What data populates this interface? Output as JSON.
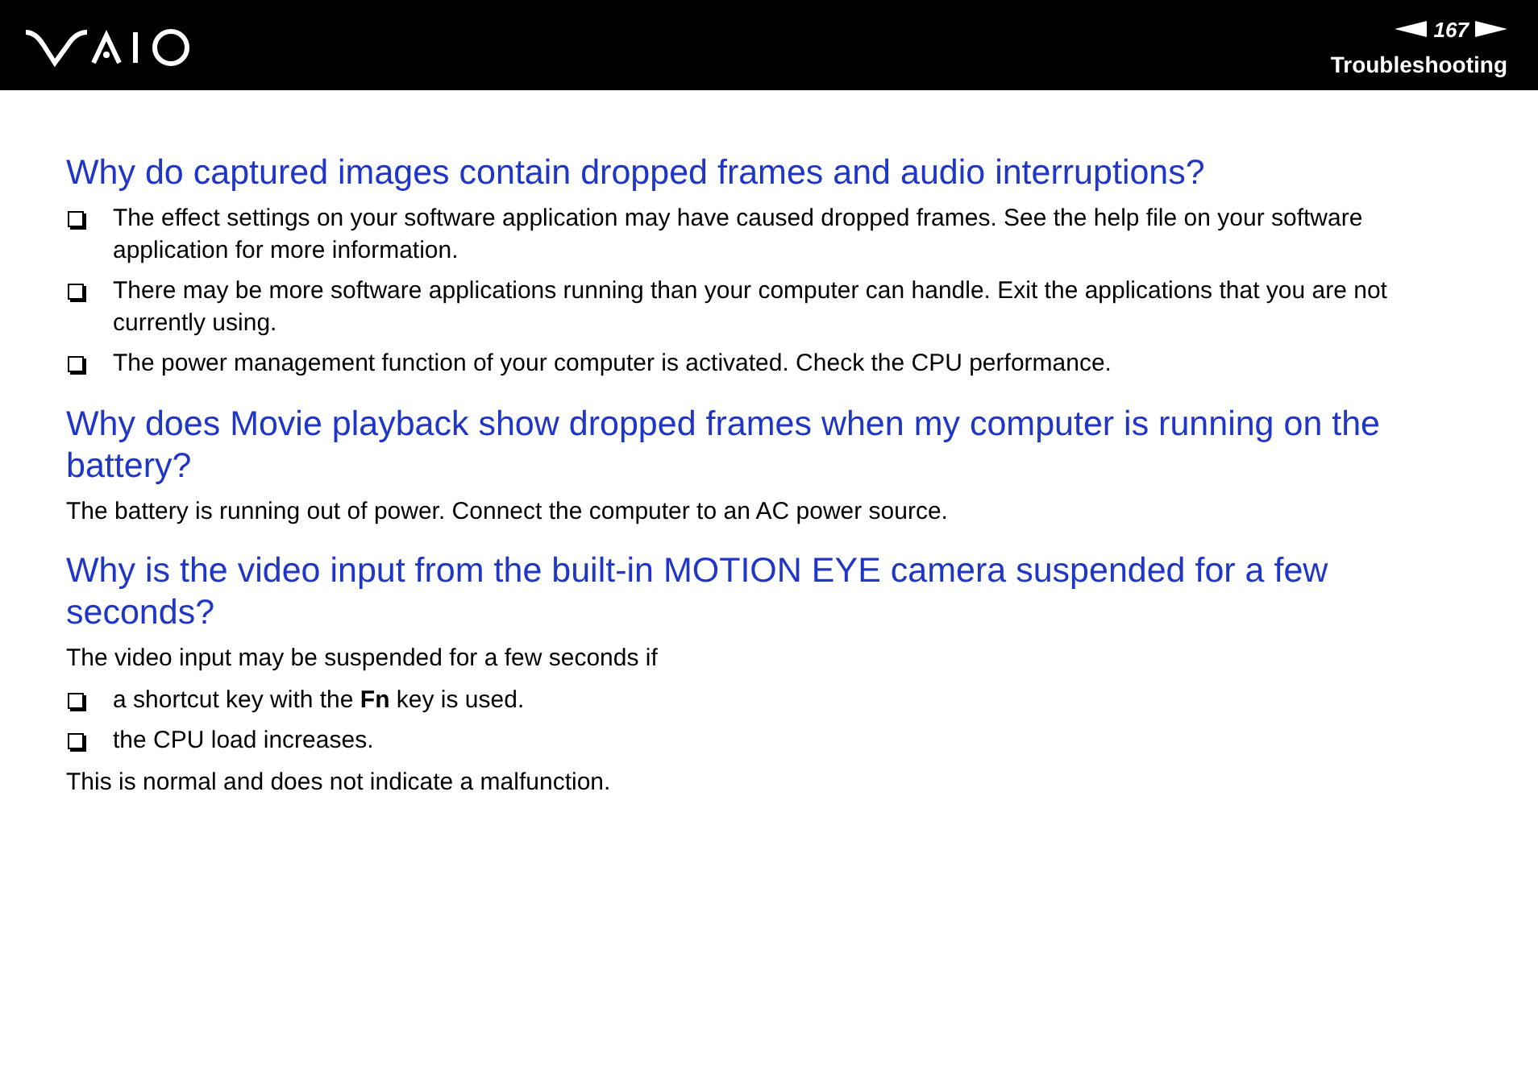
{
  "header": {
    "page_number": "167",
    "section": "Troubleshooting"
  },
  "sections": [
    {
      "heading": "Why do captured images contain dropped frames and audio interruptions?",
      "blocks": [
        {
          "kind": "bullet",
          "text": "The effect settings on your software application may have caused dropped frames. See the help file on your software application for more information."
        },
        {
          "kind": "bullet",
          "text": "There may be more software applications running than your computer can handle. Exit the applications that you are not currently using."
        },
        {
          "kind": "bullet",
          "text": "The power management function of your computer is activated. Check the CPU performance."
        }
      ]
    },
    {
      "heading": "Why does Movie playback show dropped frames when my computer is running on the battery?",
      "blocks": [
        {
          "kind": "paragraph",
          "text": "The battery is running out of power. Connect the computer to an AC power source."
        }
      ]
    },
    {
      "heading": "Why is the video input from the built-in MOTION EYE camera suspended for a few seconds?",
      "blocks": [
        {
          "kind": "paragraph",
          "text": "The video input may be suspended for a few seconds if"
        },
        {
          "kind": "bullet",
          "text": "a shortcut key with the **Fn** key is used."
        },
        {
          "kind": "bullet",
          "text": "the CPU load increases."
        },
        {
          "kind": "paragraph",
          "text": "This is normal and does not indicate a malfunction."
        }
      ]
    }
  ]
}
